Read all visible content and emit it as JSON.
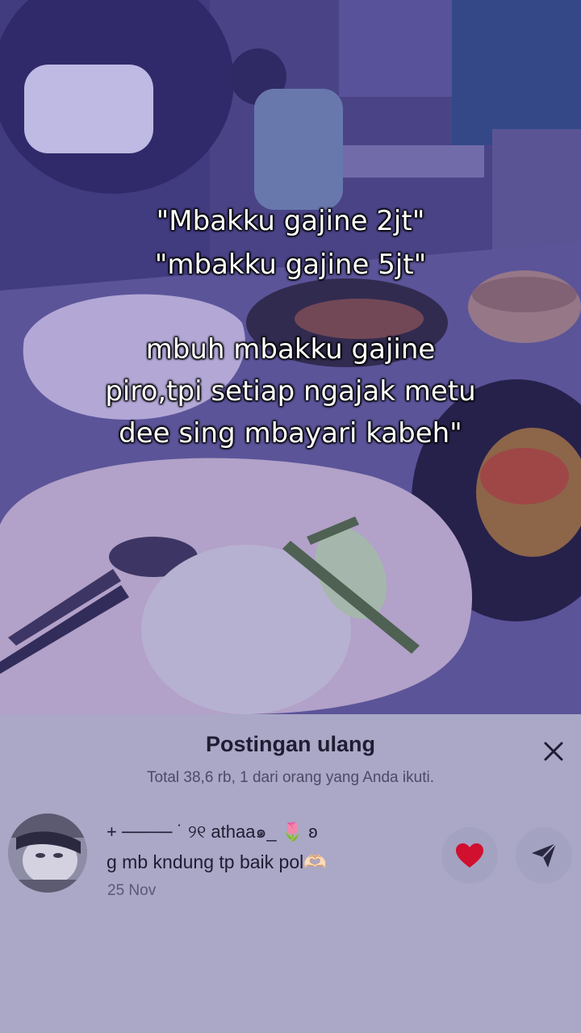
{
  "video": {
    "caption_lines": [
      "\"Mbakku gajine 2jt\"",
      "\"mbakku gajine 5jt\"",
      "mbuh mbakku gajine",
      "piro,tpi setiap ngajak metu",
      "dee sing mbayari kabeh\""
    ]
  },
  "repost_sheet": {
    "title": "Postingan ulang",
    "subtitle": "Total 38,6 rb, 1 dari orang yang Anda ikuti.",
    "close_icon": "close-icon",
    "items": [
      {
        "username": "+ ──── ˙ ୨୧ athaa๑_ 🌷 ʚ",
        "comment": "g mb kndung tp baik pol🫶🏻",
        "date": "25 Nov",
        "like_icon": "heart-icon",
        "send_icon": "send-icon"
      }
    ]
  },
  "colors": {
    "sheet_background": "#aaa8c6",
    "heart": "#d0102e",
    "text_primary": "#1f1d33"
  }
}
